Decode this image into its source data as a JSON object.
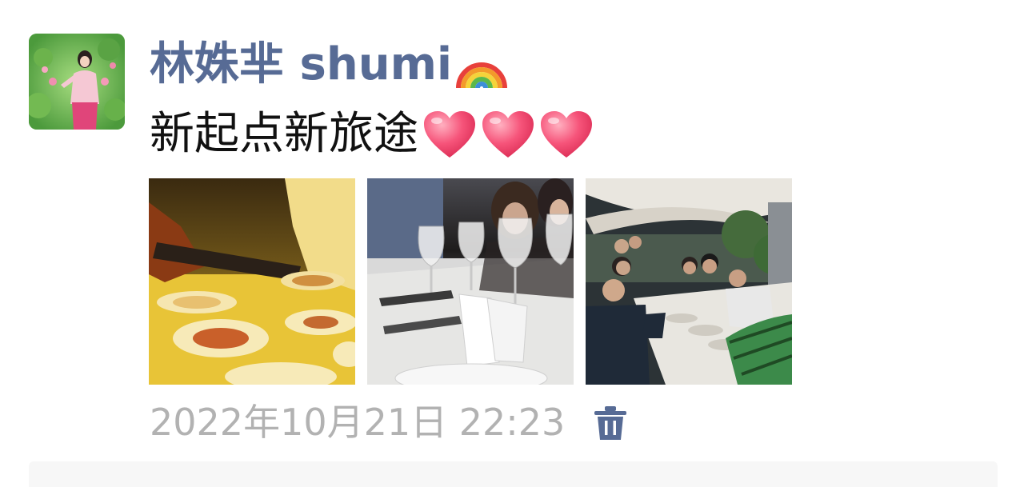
{
  "post": {
    "author_name": "林姝芈 shumi",
    "author_emoji": "rainbow-emoji",
    "content_text": "新起点新旅途",
    "content_emojis": [
      "heart-emoji",
      "heart-emoji",
      "heart-emoji"
    ],
    "photos": [
      {
        "name": "photo-food-plating",
        "subject": "table with plates under yellow light"
      },
      {
        "name": "photo-table-setting",
        "subject": "dinner table with wine glasses"
      },
      {
        "name": "photo-group-dinner",
        "subject": "group dining outdoors under umbrellas"
      }
    ],
    "timestamp": "2022年10月21日  22:23",
    "delete_icon": "trash-icon"
  },
  "colors": {
    "author_name": "#576b95",
    "timestamp": "#b2b2b2",
    "comment_area": "#f7f7f7"
  }
}
